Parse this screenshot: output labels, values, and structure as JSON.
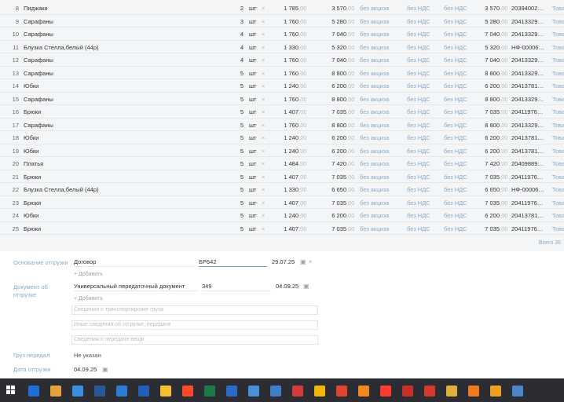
{
  "rows": [
    {
      "n": "8",
      "name": "Пиджаки",
      "qty": "2",
      "unit": "шт",
      "x": "×",
      "price": "1 785",
      "price_k": ",00",
      "sum": "3 570",
      "sum_k": ",00",
      "excise": "без акциза",
      "vat1": "без НДС",
      "vat2": "без НДС",
      "total": "3 570",
      "total_k": ",00",
      "code": "20394002…",
      "kind": "Това"
    },
    {
      "n": "9",
      "name": "Сарафаны",
      "qty": "3",
      "unit": "шт",
      "x": "×",
      "price": "1 760",
      "price_k": ",00",
      "sum": "5 280",
      "sum_k": ",00",
      "excise": "без акциза",
      "vat1": "без НДС",
      "vat2": "без НДС",
      "total": "5 280",
      "total_k": ",00",
      "code": "20413329…",
      "kind": "Това"
    },
    {
      "n": "10",
      "name": "Сарафаны",
      "qty": "4",
      "unit": "шт",
      "x": "×",
      "price": "1 760",
      "price_k": ",00",
      "sum": "7 040",
      "sum_k": ",00",
      "excise": "без акциза",
      "vat1": "без НДС",
      "vat2": "без НДС",
      "total": "7 040",
      "total_k": ",00",
      "code": "20413329…",
      "kind": "Това"
    },
    {
      "n": "11",
      "name": "Блузка Стелла,белый (44р)",
      "qty": "4",
      "unit": "шт",
      "x": "×",
      "price": "1 330",
      "price_k": ",00",
      "sum": "5 320",
      "sum_k": ",00",
      "excise": "без акциза",
      "vat1": "без НДС",
      "vat2": "без НДС",
      "total": "5 320",
      "total_k": ",00",
      "code": "НФ-00006…",
      "kind": "Това"
    },
    {
      "n": "12",
      "name": "Сарафаны",
      "qty": "4",
      "unit": "шт",
      "x": "×",
      "price": "1 760",
      "price_k": ",00",
      "sum": "7 040",
      "sum_k": ",00",
      "excise": "без акциза",
      "vat1": "без НДС",
      "vat2": "без НДС",
      "total": "7 040",
      "total_k": ",00",
      "code": "20413329…",
      "kind": "Това"
    },
    {
      "n": "13",
      "name": "Сарафаны",
      "qty": "5",
      "unit": "шт",
      "x": "×",
      "price": "1 760",
      "price_k": ",00",
      "sum": "8 800",
      "sum_k": ",00",
      "excise": "без акциза",
      "vat1": "без НДС",
      "vat2": "без НДС",
      "total": "8 800",
      "total_k": ",00",
      "code": "20413329…",
      "kind": "Това"
    },
    {
      "n": "14",
      "name": "Юбки",
      "qty": "5",
      "unit": "шт",
      "x": "×",
      "price": "1 240",
      "price_k": ",00",
      "sum": "6 200",
      "sum_k": ",00",
      "excise": "без акциза",
      "vat1": "без НДС",
      "vat2": "без НДС",
      "total": "6 200",
      "total_k": ",00",
      "code": "20413781…",
      "kind": "Това"
    },
    {
      "n": "15",
      "name": "Сарафаны",
      "qty": "5",
      "unit": "шт",
      "x": "×",
      "price": "1 760",
      "price_k": ",00",
      "sum": "8 800",
      "sum_k": ",00",
      "excise": "без акциза",
      "vat1": "без НДС",
      "vat2": "без НДС",
      "total": "8 800",
      "total_k": ",00",
      "code": "20413329…",
      "kind": "Това"
    },
    {
      "n": "16",
      "name": "Брюки",
      "qty": "5",
      "unit": "шт",
      "x": "×",
      "price": "1 407",
      "price_k": ",00",
      "sum": "7 035",
      "sum_k": ",00",
      "excise": "без акциза",
      "vat1": "без НДС",
      "vat2": "без НДС",
      "total": "7 035",
      "total_k": ",00",
      "code": "20411976…",
      "kind": "Това"
    },
    {
      "n": "17",
      "name": "Сарафаны",
      "qty": "5",
      "unit": "шт",
      "x": "×",
      "price": "1 760",
      "price_k": ",00",
      "sum": "8 800",
      "sum_k": ",00",
      "excise": "без акциза",
      "vat1": "без НДС",
      "vat2": "без НДС",
      "total": "8 800",
      "total_k": ",00",
      "code": "20413329…",
      "kind": "Това"
    },
    {
      "n": "18",
      "name": "Юбки",
      "qty": "5",
      "unit": "шт",
      "x": "×",
      "price": "1 240",
      "price_k": ",00",
      "sum": "6 200",
      "sum_k": ",00",
      "excise": "без акциза",
      "vat1": "без НДС",
      "vat2": "без НДС",
      "total": "6 200",
      "total_k": ",00",
      "code": "20413781…",
      "kind": "Това"
    },
    {
      "n": "19",
      "name": "Юбки",
      "qty": "5",
      "unit": "шт",
      "x": "×",
      "price": "1 240",
      "price_k": ",00",
      "sum": "6 200",
      "sum_k": ",00",
      "excise": "без акциза",
      "vat1": "без НДС",
      "vat2": "без НДС",
      "total": "6 200",
      "total_k": ",00",
      "code": "20413781…",
      "kind": "Това"
    },
    {
      "n": "20",
      "name": "Платья",
      "qty": "5",
      "unit": "шт",
      "x": "×",
      "price": "1 484",
      "price_k": ",00",
      "sum": "7 420",
      "sum_k": ",00",
      "excise": "без акциза",
      "vat1": "без НДС",
      "vat2": "без НДС",
      "total": "7 420",
      "total_k": ",00",
      "code": "20409889…",
      "kind": "Това"
    },
    {
      "n": "21",
      "name": "Брюки",
      "qty": "5",
      "unit": "шт",
      "x": "×",
      "price": "1 407",
      "price_k": ",00",
      "sum": "7 035",
      "sum_k": ",00",
      "excise": "без акциза",
      "vat1": "без НДС",
      "vat2": "без НДС",
      "total": "7 035",
      "total_k": ",00",
      "code": "20411976…",
      "kind": "Това"
    },
    {
      "n": "22",
      "name": "Блузка Стелла,белый (44р)",
      "qty": "5",
      "unit": "шт",
      "x": "×",
      "price": "1 330",
      "price_k": ",00",
      "sum": "6 650",
      "sum_k": ",00",
      "excise": "без акциза",
      "vat1": "без НДС",
      "vat2": "без НДС",
      "total": "6 650",
      "total_k": ",00",
      "code": "НФ-00006…",
      "kind": "Това"
    },
    {
      "n": "23",
      "name": "Брюки",
      "qty": "5",
      "unit": "шт",
      "x": "×",
      "price": "1 407",
      "price_k": ",00",
      "sum": "7 035",
      "sum_k": ",00",
      "excise": "без акциза",
      "vat1": "без НДС",
      "vat2": "без НДС",
      "total": "7 035",
      "total_k": ",00",
      "code": "20411976…",
      "kind": "Това"
    },
    {
      "n": "24",
      "name": "Юбки",
      "qty": "5",
      "unit": "шт",
      "x": "×",
      "price": "1 240",
      "price_k": ",00",
      "sum": "6 200",
      "sum_k": ",00",
      "excise": "без акциза",
      "vat1": "без НДС",
      "vat2": "без НДС",
      "total": "6 200",
      "total_k": ",00",
      "code": "20413781…",
      "kind": "Това"
    },
    {
      "n": "25",
      "name": "Брюки",
      "qty": "5",
      "unit": "шт",
      "x": "×",
      "price": "1 407",
      "price_k": ",00",
      "sum": "7 035",
      "sum_k": ",00",
      "excise": "без акциза",
      "vat1": "без НДС",
      "vat2": "без НДС",
      "total": "7 035",
      "total_k": ",00",
      "code": "20411976…",
      "kind": "Това"
    }
  ],
  "total_count": "Всего 36",
  "form": {
    "basis_label": "Основание отгрузки",
    "basis_doc": "Договор",
    "basis_number": "БР642",
    "basis_date": "29.07.25",
    "add_label_1": "+ Добавить",
    "shipdoc_label": "Документ об отгрузке",
    "shipdoc_type": "Универсальный передаточный документ",
    "shipdoc_number": "349",
    "shipdoc_date": "04.09.25",
    "add_label_2": "+ Добавить",
    "transport_placeholder": "Сведения о транспортировке груза",
    "other_placeholder": "Иные сведения об отгрузке, передаче",
    "transfer_placeholder": "Сведения о передаче вещи",
    "cargo_label": "Груз передал",
    "cargo_value": "Не указан",
    "ship_date_label": "Дата отгрузки",
    "ship_date_value": "04.09.25"
  },
  "taskbar": {
    "icons": [
      {
        "name": "start-icon",
        "color": "#ffffff"
      },
      {
        "name": "app-blue-window-icon",
        "color": "#1e6fd9"
      },
      {
        "name": "photo-app-icon",
        "color": "#e8a23a"
      },
      {
        "name": "edge-browser-icon",
        "color": "#3a8fe0"
      },
      {
        "name": "word-icon",
        "color": "#2b5797"
      },
      {
        "name": "app-blue-square-icon",
        "color": "#2d7cd6"
      },
      {
        "name": "app-blue-chart-icon",
        "color": "#1f5fb8"
      },
      {
        "name": "file-explorer-icon",
        "color": "#f2c230"
      },
      {
        "name": "yandex-browser-icon",
        "color": "#ff4b2b"
      },
      {
        "name": "excel-icon",
        "color": "#1d7a45"
      },
      {
        "name": "app-blue-card-icon",
        "color": "#2a6bc7"
      },
      {
        "name": "tools-icon",
        "color": "#4a90d9"
      },
      {
        "name": "network-icon",
        "color": "#3f7fc9"
      },
      {
        "name": "red-circle-app-icon",
        "color": "#d43b3b"
      },
      {
        "name": "1c-icon",
        "color": "#f2b705"
      },
      {
        "name": "app-red-arrow-icon",
        "color": "#e0452f"
      },
      {
        "name": "app-orange-1c-icon",
        "color": "#f08a1c"
      },
      {
        "name": "yandex-browser-2-icon",
        "color": "#ff3c2f"
      },
      {
        "name": "pdf-reader-icon",
        "color": "#c9302c"
      },
      {
        "name": "app-red-square-icon",
        "color": "#d63a2e"
      },
      {
        "name": "chrome-icon",
        "color": "#e0b03c"
      },
      {
        "name": "firefox-icon",
        "color": "#f07a1f"
      },
      {
        "name": "app-orange-cross-icon",
        "color": "#f0a020"
      },
      {
        "name": "app-window-icon",
        "color": "#4d86c9"
      }
    ]
  }
}
